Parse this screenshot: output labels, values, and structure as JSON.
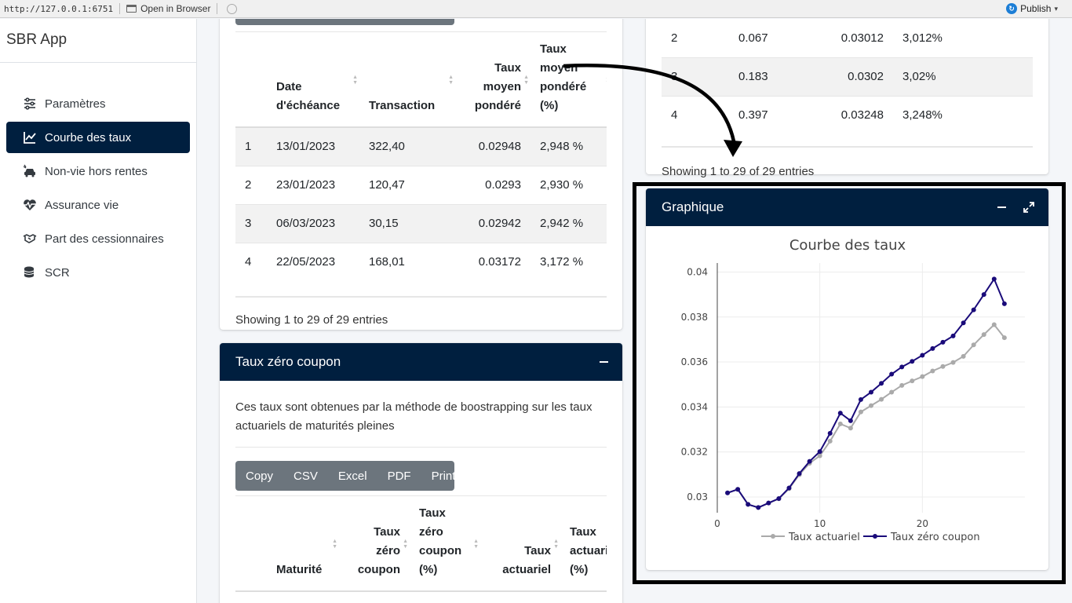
{
  "browser": {
    "url": "http://127.0.0.1:6751",
    "open_label": "Open in Browser",
    "publish_label": "Publish"
  },
  "sidebar": {
    "brand": "SBR App",
    "items": [
      {
        "label": "Paramètres",
        "icon": "sliders-icon",
        "active": false
      },
      {
        "label": "Courbe des taux",
        "icon": "line-chart-icon",
        "active": true
      },
      {
        "label": "Non-vie hors rentes",
        "icon": "car-crash-icon",
        "active": false
      },
      {
        "label": "Assurance vie",
        "icon": "heartbeat-icon",
        "active": false
      },
      {
        "label": "Part des cessionnaires",
        "icon": "handshake-icon",
        "active": false
      },
      {
        "label": "SCR",
        "icon": "coins-icon",
        "active": false
      }
    ]
  },
  "transactions_card": {
    "headers": [
      "",
      "Date d'échéance",
      "Transaction",
      "Taux moyen pondéré",
      "Taux moyen pondéré (%)"
    ],
    "rows": [
      [
        "1",
        "13/01/2023",
        "322,40",
        "0.02948",
        "2,948 %"
      ],
      [
        "2",
        "23/01/2023",
        "120,47",
        "0.0293",
        "2,930 %"
      ],
      [
        "3",
        "06/03/2023",
        "30,15",
        "0.02942",
        "2,942 %"
      ],
      [
        "4",
        "22/05/2023",
        "168,01",
        "0.03172",
        "3,172 %"
      ]
    ],
    "info": "Showing 1 to 29 of 29 entries"
  },
  "zero_coupon_card": {
    "title": "Taux zéro coupon",
    "description": "Ces taux sont obtenues par la méthode de boostrapping sur les taux actuariels de maturités pleines",
    "buttons": [
      "Copy",
      "CSV",
      "Excel",
      "PDF",
      "Print"
    ],
    "headers": [
      "Maturité",
      "Taux zéro coupon",
      "Taux zéro coupon (%)",
      "Taux actuariel",
      "Taux actuariel (%)"
    ]
  },
  "right_table_card": {
    "rows": [
      [
        "2",
        "0.067",
        "0.03012",
        "3,012%"
      ],
      [
        "3",
        "0.183",
        "0.0302",
        "3,02%"
      ],
      [
        "4",
        "0.397",
        "0.03248",
        "3,248%"
      ]
    ],
    "info": "Showing 1 to 29 of 29 entries"
  },
  "graph_card": {
    "title": "Graphique"
  },
  "chart_data": {
    "type": "line",
    "title": "Courbe des taux",
    "xlim": [
      0,
      30
    ],
    "ylim": [
      0.0293,
      0.0404
    ],
    "xticks": [
      0,
      10,
      20
    ],
    "yticks": [
      0.03,
      0.032,
      0.034,
      0.036,
      0.038,
      0.04
    ],
    "legend_position": "bottom",
    "series": [
      {
        "name": "Taux actuariel",
        "color": "#aaaaaa",
        "x": [
          1,
          2,
          3,
          4,
          5,
          6,
          7,
          8,
          9,
          10,
          11,
          12,
          13,
          14,
          15,
          16,
          17,
          18,
          19,
          20,
          21,
          22,
          23,
          24,
          25,
          26,
          27,
          28
        ],
        "values": [
          0.03018,
          0.03034,
          0.02967,
          0.02953,
          0.02973,
          0.02992,
          0.03037,
          0.03099,
          0.0315,
          0.03183,
          0.03248,
          0.03325,
          0.03306,
          0.03378,
          0.03406,
          0.03434,
          0.03466,
          0.03496,
          0.03516,
          0.03535,
          0.0356,
          0.0358,
          0.03598,
          0.03625,
          0.03676,
          0.03722,
          0.03766,
          0.03708
        ]
      },
      {
        "name": "Taux zéro coupon",
        "color": "#1a0b7a",
        "x": [
          1,
          2,
          3,
          4,
          5,
          6,
          7,
          8,
          9,
          10,
          11,
          12,
          13,
          14,
          15,
          16,
          17,
          18,
          19,
          20,
          21,
          22,
          23,
          24,
          25,
          26,
          27,
          28
        ],
        "values": [
          0.03018,
          0.03034,
          0.02967,
          0.02953,
          0.02973,
          0.02993,
          0.0304,
          0.03104,
          0.03158,
          0.03202,
          0.03283,
          0.03373,
          0.03339,
          0.03433,
          0.03466,
          0.03505,
          0.03546,
          0.03578,
          0.03603,
          0.0363,
          0.0366,
          0.03688,
          0.03716,
          0.03774,
          0.03832,
          0.039,
          0.03969,
          0.03859
        ]
      }
    ]
  }
}
